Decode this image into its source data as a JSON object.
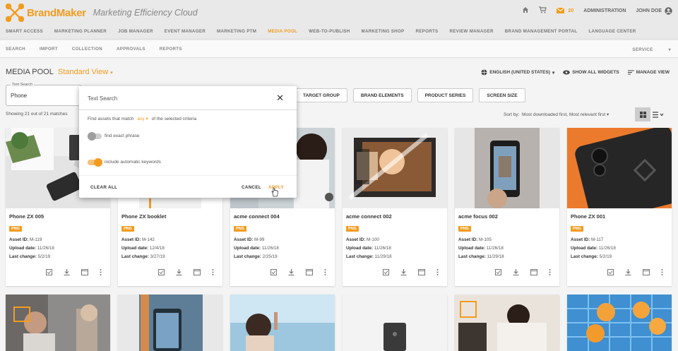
{
  "brand": {
    "name": "BrandMaker",
    "tagline": "Marketing Efficiency Cloud",
    "color": "#f29c1f"
  },
  "top_right": {
    "mail_count": "20",
    "admin": "ADMINISTRATION",
    "user": "JOHN DOE"
  },
  "main_nav": [
    "SMART ACCESS",
    "MARKETING PLANNER",
    "JOB MANAGER",
    "EVENT MANAGER",
    "MARKETING PTM",
    "MEDIA POOL",
    "WEB-TO-PUBLISH",
    "MARKETING SHOP",
    "REPORTS",
    "REVIEW MANAGER",
    "BRAND MANAGEMENT PORTAL",
    "LANGUAGE CENTER"
  ],
  "main_nav_active": "MEDIA POOL",
  "sub_nav": [
    "SEARCH",
    "IMPORT",
    "COLLECTION",
    "APPROVALS",
    "REPORTS"
  ],
  "service": "SERVICE",
  "page": {
    "title": "MEDIA POOL",
    "view": "Standard View"
  },
  "tools": {
    "language": "ENGLISH (UNITED STATES)",
    "show_widgets": "SHOW ALL WIDGETS",
    "manage_view": "MANAGE VIEW"
  },
  "search": {
    "label": "Text Search",
    "value": "Phone"
  },
  "filters": [
    "TARGET GROUP",
    "BRAND ELEMENTS",
    "PRODUCT SERIES",
    "SCREEN SIZE"
  ],
  "showing": "Showing 21 out of 21 matches",
  "sort": {
    "label": "Sort by:",
    "value": "Most downloaded first, Most relevant first"
  },
  "popup": {
    "title": "Text Search",
    "match_pre": "Find assets that match",
    "match_any": "any",
    "match_post": "of the selected criteria",
    "opt1": "find exact phrase",
    "opt2": "include automatic keywords",
    "clear": "CLEAR ALL",
    "cancel": "CANCEL",
    "apply": "APPLY"
  },
  "labels": {
    "asset_id": "Asset ID:",
    "upload": "Upload date:",
    "change": "Last change:"
  },
  "assets": [
    {
      "name": "Phone ZX 005",
      "type": "PNG",
      "id": "M-119",
      "upload": "11/26/18",
      "change": "5/2/19"
    },
    {
      "name": "Phone ZX booklet",
      "type": "PNG",
      "id": "M-142",
      "upload": "12/4/18",
      "change": "3/27/19"
    },
    {
      "name": "acme connect 004",
      "type": "PNG",
      "id": "M-99",
      "upload": "11/26/18",
      "change": "2/25/19"
    },
    {
      "name": "acme connect 002",
      "type": "PNG",
      "id": "M-100",
      "upload": "11/26/18",
      "change": "11/29/18"
    },
    {
      "name": "acme focus 002",
      "type": "PNG",
      "id": "M-105",
      "upload": "11/26/18",
      "change": "11/29/18"
    },
    {
      "name": "Phone ZX 001",
      "type": "PNG",
      "id": "M-117",
      "upload": "11/26/18",
      "change": "5/2/19"
    }
  ]
}
